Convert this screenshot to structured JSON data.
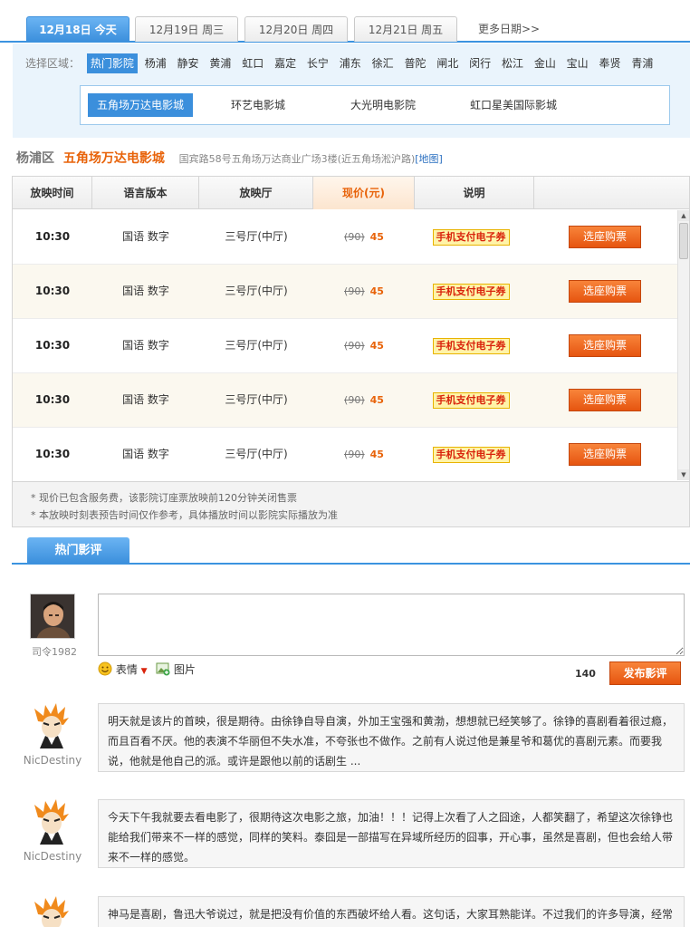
{
  "date_tabs": [
    {
      "label": "12月18日  今天",
      "active": true
    },
    {
      "label": "12月19日  周三",
      "active": false
    },
    {
      "label": "12月20日  周四",
      "active": false
    },
    {
      "label": "12月21日  周五",
      "active": false
    }
  ],
  "more_dates": "更多日期>>",
  "region": {
    "label": "选择区域：",
    "items": [
      "热门影院",
      "杨浦",
      "静安",
      "黄浦",
      "虹口",
      "嘉定",
      "长宁",
      "浦东",
      "徐汇",
      "普陀",
      "闸北",
      "闵行",
      "松江",
      "金山",
      "宝山",
      "奉贤",
      "青浦"
    ],
    "active_index": 0
  },
  "cinemas": {
    "items": [
      "五角场万达电影城",
      "环艺电影城",
      "大光明电影院",
      "虹口星美国际影城"
    ],
    "active_index": 0
  },
  "cinema_info": {
    "district": "杨浦区",
    "name": "五角场万达电影城",
    "address": "国宾路58号五角场万达商业广场3楼(近五角场淞沪路)",
    "map_link": "[地图]"
  },
  "table": {
    "headers": [
      "放映时间",
      "语言版本",
      "放映厅",
      "现价(元)",
      "说明"
    ],
    "rows": [
      {
        "time": "10:30",
        "lang": "国语  数字",
        "hall": "三号厅(中厅)",
        "old_price": "(90)",
        "price": "45",
        "note": "手机支付电子券",
        "button": "选座购票"
      },
      {
        "time": "10:30",
        "lang": "国语  数字",
        "hall": "三号厅(中厅)",
        "old_price": "(90)",
        "price": "45",
        "note": "手机支付电子券",
        "button": "选座购票"
      },
      {
        "time": "10:30",
        "lang": "国语  数字",
        "hall": "三号厅(中厅)",
        "old_price": "(90)",
        "price": "45",
        "note": "手机支付电子券",
        "button": "选座购票"
      },
      {
        "time": "10:30",
        "lang": "国语  数字",
        "hall": "三号厅(中厅)",
        "old_price": "(90)",
        "price": "45",
        "note": "手机支付电子券",
        "button": "选座购票"
      },
      {
        "time": "10:30",
        "lang": "国语  数字",
        "hall": "三号厅(中厅)",
        "old_price": "(90)",
        "price": "45",
        "note": "手机支付电子券",
        "button": "选座购票"
      }
    ],
    "notes": [
      "* 现价已包含服务费，该影院订座票放映前120分钟关闭售票",
      "* 本放映时刻表预告时间仅作参考，具体播放时间以影院实际播放为准"
    ]
  },
  "reviews_section": {
    "tab_label": "热门影评",
    "current_user": "司令1982",
    "emoji_label": "表情",
    "image_label": "图片",
    "char_count": "140",
    "post_button": "发布影评",
    "reviews": [
      {
        "user": "NicDestiny",
        "text": "明天就是该片的首映，很是期待。由徐铮自导自演，外加王宝强和黄渤，想想就已经笑够了。徐铮的喜剧看着很过瘾，而且百看不厌。他的表演不华丽但不失水准，不夸张也不做作。之前有人说过他是兼星爷和葛优的喜剧元素。而要我说，他就是他自己的派。或许是跟他以前的话剧生 ..."
      },
      {
        "user": "NicDestiny",
        "text": "今天下午我就要去看电影了，很期待这次电影之旅，加油！！！记得上次看了人之囧途，人都笑翻了，希望这次徐铮也能给我们带来不一样的感觉，同样的笑料。泰囧是一部描写在异域所经历的囧事，开心事，虽然是喜剧，但也会给人带来不一样的感觉。"
      },
      {
        "user": "",
        "text": "神马是喜剧，鲁迅大爷说过，就是把没有价值的东西破坏给人看。这句话，大家耳熟能详。不过我们的许多导演，经常"
      }
    ]
  },
  "colors": {
    "accent_blue": "#3b8fdc",
    "accent_orange": "#e8630a",
    "button_orange": "#e65510"
  }
}
